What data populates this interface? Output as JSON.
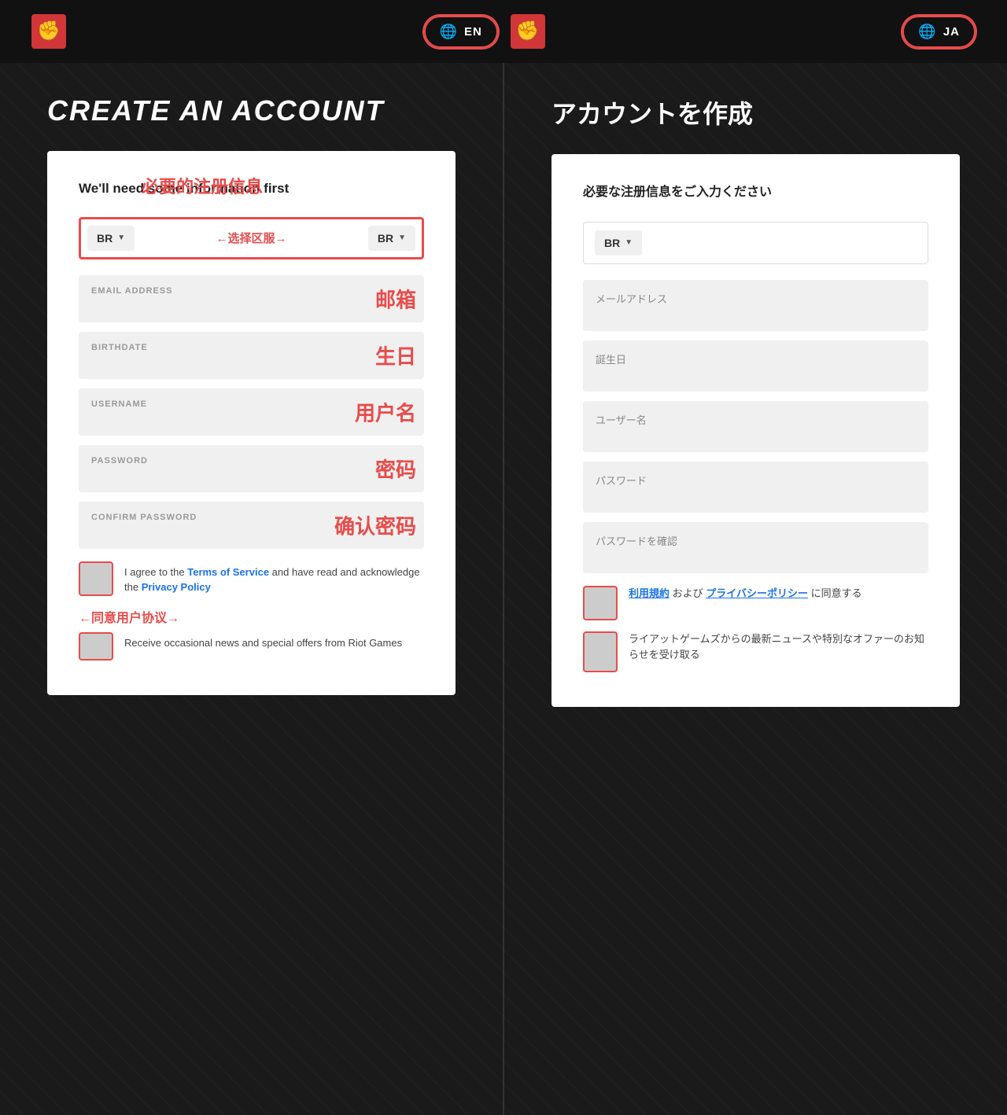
{
  "header": {
    "lang_en_label": "EN",
    "lang_ja_label": "JA",
    "fist_icon_left": "✊",
    "fist_icon_center": "✊",
    "fist_icon_right": "✊"
  },
  "left_panel": {
    "title": "CREATE AN ACCOUNT",
    "subtitle": "We'll need some information first",
    "region_label": "←选择区服→",
    "region_value": "BR",
    "region_value2": "BR",
    "fields": [
      {
        "label": "EMAIL ADDRESS",
        "placeholder": ""
      },
      {
        "label": "BIRTHDATE",
        "placeholder": ""
      },
      {
        "label": "USERNAME",
        "placeholder": ""
      },
      {
        "label": "PASSWORD",
        "placeholder": ""
      },
      {
        "label": "CONFIRM PASSWORD",
        "placeholder": ""
      }
    ],
    "checkbox1_text_part1": "I agree to the ",
    "checkbox1_link1": "Terms of Service",
    "checkbox1_text_part2": " and have read and acknowledge the ",
    "checkbox1_link2": "Privacy Policy",
    "checkbox2_text": "Receive occasional news and special offers from Riot Games",
    "annotation_email": "邮箱",
    "annotation_birthday": "生日",
    "annotation_username": "用户名",
    "annotation_password": "密码",
    "annotation_confirm": "确认密码",
    "annotation_agree": "←同意用户协议→",
    "annotation_region": "←选择区服→",
    "annotation_required": "必要的注册信息"
  },
  "right_panel": {
    "title": "アカウントを作成",
    "subtitle": "必要な注册信息をご入力ください",
    "region_value": "BR",
    "fields": [
      {
        "label": "メールアドレス",
        "placeholder": ""
      },
      {
        "label": "誕生日",
        "placeholder": ""
      },
      {
        "label": "ユーザー名",
        "placeholder": ""
      },
      {
        "label": "パスワード",
        "placeholder": ""
      },
      {
        "label": "パスワードを確認",
        "placeholder": ""
      }
    ],
    "checkbox1_text": "利用規約およびプライバシーポリシーに同意する",
    "checkbox1_link1": "利用規約",
    "checkbox1_link2": "プライバシーポリシー",
    "checkbox2_text": "ライアットゲームズからの最新ニュースや特別なオファーのお知らせを受け取る"
  }
}
